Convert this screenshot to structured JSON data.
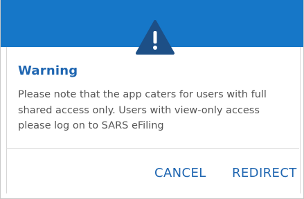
{
  "dialog": {
    "icon": "warning-icon",
    "title": "Warning",
    "message": "Please note that the app caters for users with full shared access only. Users with view-only access please log on to SARS eFiling",
    "buttons": {
      "cancel": "CANCEL",
      "redirect": "REDIRECT"
    }
  },
  "colors": {
    "header": "#1677c8",
    "accent": "#1f66b1",
    "icon": "#1d4f86",
    "text": "#555555"
  }
}
